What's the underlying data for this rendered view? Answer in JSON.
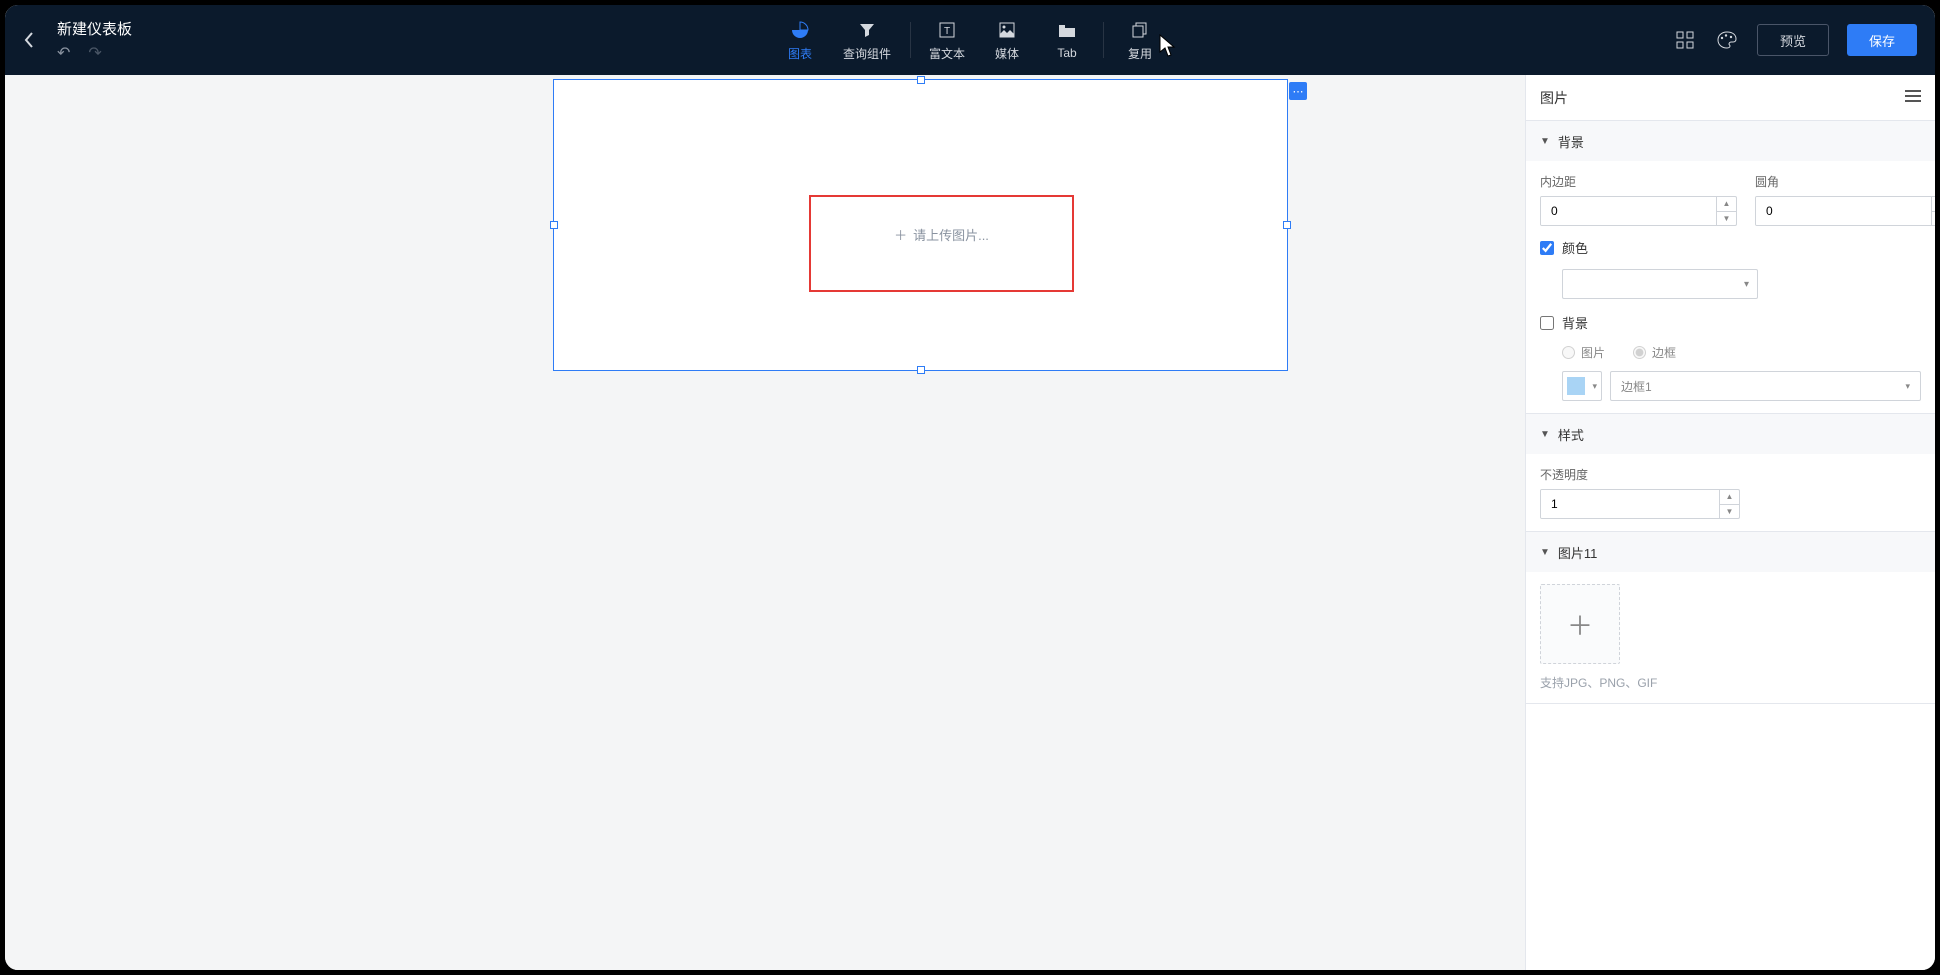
{
  "header": {
    "title": "新建仪表板",
    "preview": "预览",
    "save": "保存"
  },
  "tools": {
    "chart": "图表",
    "query": "查询组件",
    "richtext": "富文本",
    "media": "媒体",
    "tab": "Tab",
    "reuse": "复用"
  },
  "canvas": {
    "upload_placeholder": "请上传图片..."
  },
  "panel": {
    "title": "图片",
    "sections": {
      "background": {
        "label": "背景",
        "padding_label": "内边距",
        "padding_value": "0",
        "radius_label": "圆角",
        "radius_value": "0",
        "color_label": "颜色",
        "color_checked": true,
        "bg_label": "背景",
        "bg_checked": false,
        "bg_option_image": "图片",
        "bg_option_border": "边框",
        "border_option": "边框1"
      },
      "style": {
        "label": "样式",
        "opacity_label": "不透明度",
        "opacity_value": "1"
      },
      "image": {
        "label": "图片11",
        "hint": "支持JPG、PNG、GIF"
      }
    }
  }
}
